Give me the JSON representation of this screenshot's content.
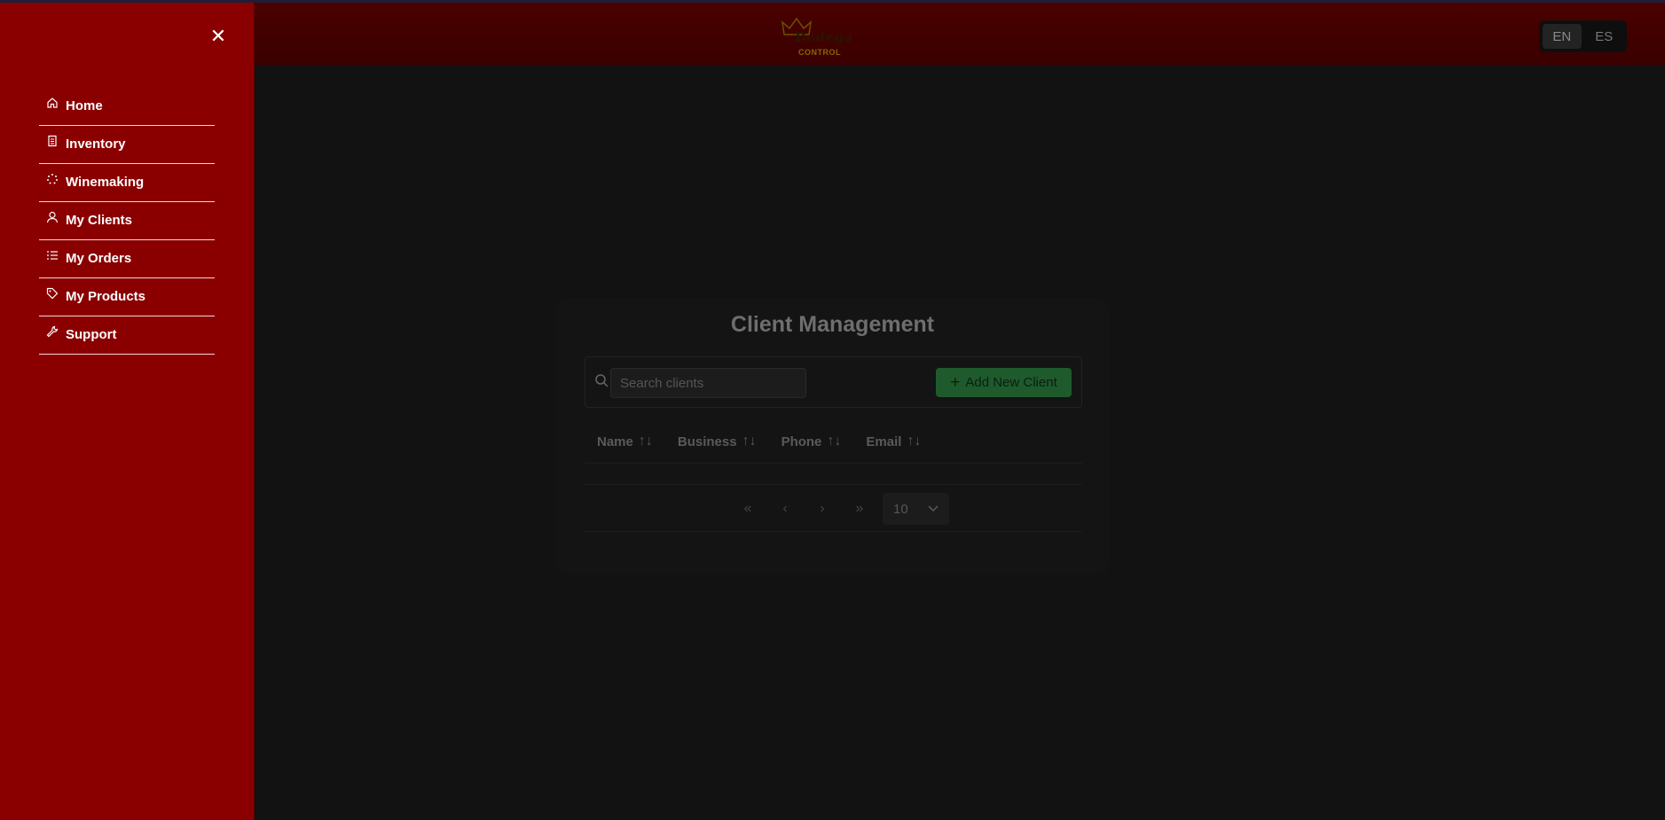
{
  "header": {
    "logo_text": "Bodega",
    "logo_subtext": "CONTROL",
    "languages": [
      {
        "code": "EN",
        "active": true
      },
      {
        "code": "ES",
        "active": false
      }
    ]
  },
  "drawer": {
    "close_icon": "close-icon",
    "items": [
      {
        "label": "Home",
        "icon": "home-icon"
      },
      {
        "label": "Inventory",
        "icon": "clipboard-icon"
      },
      {
        "label": "Winemaking",
        "icon": "loader-icon"
      },
      {
        "label": "My Clients",
        "icon": "user-icon"
      },
      {
        "label": "My Orders",
        "icon": "list-icon"
      },
      {
        "label": "My Products",
        "icon": "tag-icon"
      },
      {
        "label": "Support",
        "icon": "wrench-icon"
      }
    ]
  },
  "main": {
    "title": "Client Management",
    "search": {
      "placeholder": "Search clients",
      "value": ""
    },
    "add_button": "Add New Client",
    "columns": [
      "Name",
      "Business",
      "Phone",
      "Email"
    ],
    "pagination": {
      "first": "«",
      "prev": "‹",
      "next": "›",
      "last": "»",
      "page_size": "10"
    }
  },
  "colors": {
    "drawer_bg": "#8a0000",
    "topbar_bg": "#3a0000",
    "page_bg": "#121212",
    "add_button_bg": "#1e5a2c"
  }
}
